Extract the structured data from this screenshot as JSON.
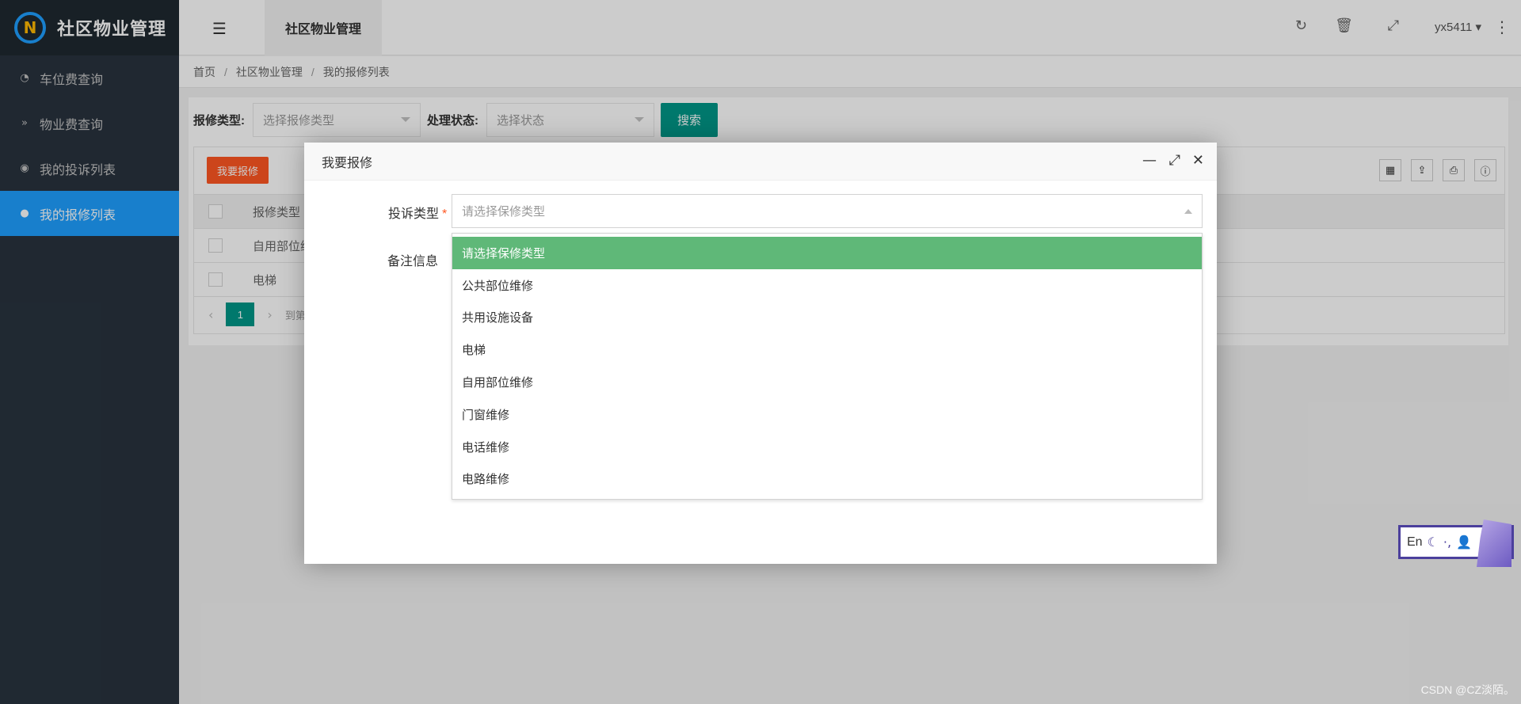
{
  "app": {
    "logo_initial": "N",
    "title": "社区物业管理"
  },
  "sidebar": {
    "items": [
      {
        "icon": "dashboard-icon",
        "glyph": "◔",
        "label": "车位费查询"
      },
      {
        "icon": "double-chevron-icon",
        "glyph": "»",
        "label": "物业费查询"
      },
      {
        "icon": "target-icon",
        "glyph": "◉",
        "label": "我的投诉列表"
      },
      {
        "icon": "chevron-circle-icon",
        "glyph": "●",
        "label": "我的报修列表",
        "active": true
      }
    ]
  },
  "header": {
    "tab": "社区物业管理",
    "user": "yx5411 ▾"
  },
  "breadcrumb": {
    "home": "首页",
    "section": "社区物业管理",
    "page": "我的报修列表"
  },
  "filter": {
    "type_label": "报修类型:",
    "type_placeholder": "选择报修类型",
    "status_label": "处理状态:",
    "status_placeholder": "选择状态",
    "search_button": "搜索"
  },
  "table": {
    "add_button": "我要报修",
    "header": "报修类型",
    "rows": [
      "自用部位维",
      "电梯"
    ],
    "page": "1",
    "goto_partial": "到第"
  },
  "modal": {
    "title": "我要报修",
    "type_label": "投诉类型",
    "required_mark": "*",
    "note_label": "备注信息",
    "select_placeholder": "请选择保修类型",
    "options": [
      "请选择保修类型",
      "公共部位维修",
      "共用设施设备",
      "电梯",
      "自用部位维修",
      "门窗维修",
      "电话维修",
      "电路维修"
    ]
  },
  "widget": {
    "lang": "En"
  },
  "watermark": "CSDN @CZ淡陌。",
  "colors": {
    "accent_blue": "#1e9fff",
    "primary_green": "#009688",
    "danger_orange": "#ff5722",
    "option_selected": "#5fb878",
    "sidebar_bg": "#28333e"
  }
}
